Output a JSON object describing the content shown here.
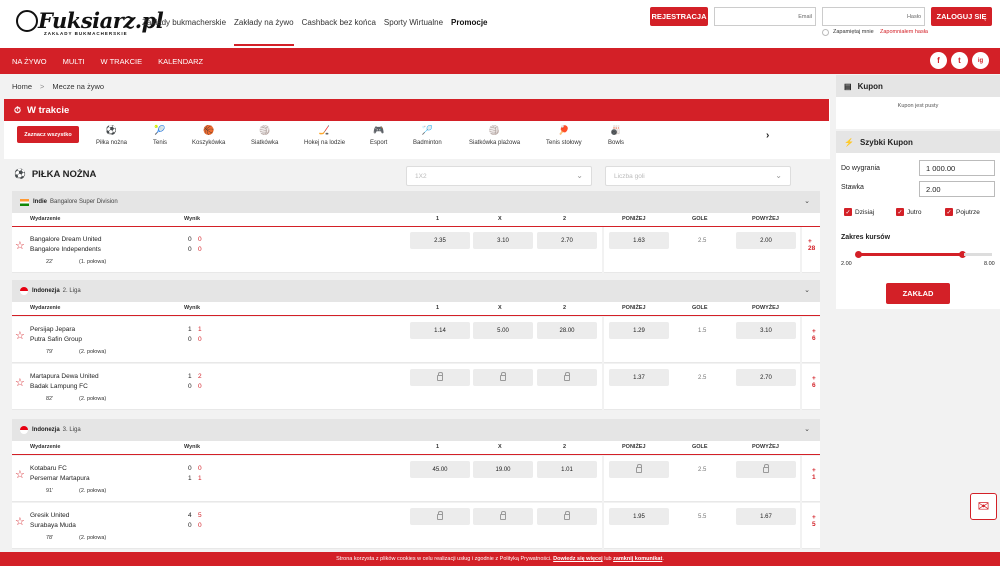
{
  "logo": {
    "text": "Fuksiarz.pl",
    "subtext": "ZAKŁADY BUKMACHERSKIE"
  },
  "topnav": [
    "Zakłady bukmacherskie",
    "Zakłady na żywo",
    "Cashback bez końca",
    "Sporty Wirtualne",
    "Promocje"
  ],
  "auth": {
    "register": "REJESTRACJA",
    "email_placeholder": "Email",
    "password_placeholder": "Hasło",
    "remember": "Zapamiętaj mnie",
    "forgot": "Zapomniałem hasła",
    "login": "ZALOGUJ SIĘ"
  },
  "rednav": [
    "NA ŻYWO",
    "MULTI",
    "W TRAKCIE",
    "KALENDARZ"
  ],
  "social": [
    "f",
    "t",
    "ig"
  ],
  "breadcrumb": {
    "home": "Home",
    "current": "Mecze na żywo"
  },
  "section_title": "W trakcie",
  "select_all": "Zaznacz wszystko",
  "sports": [
    {
      "icon": "soccer-ball-icon",
      "glyph": "⚽",
      "label": "Piłka nożna"
    },
    {
      "icon": "tennis-icon",
      "glyph": "🎾",
      "label": "Tenis"
    },
    {
      "icon": "basketball-icon",
      "glyph": "🏀",
      "label": "Koszykówka"
    },
    {
      "icon": "volleyball-icon",
      "glyph": "🏐",
      "label": "Siatkówka"
    },
    {
      "icon": "hockey-icon",
      "glyph": "🏒",
      "label": "Hokej na lodzie"
    },
    {
      "icon": "gamepad-icon",
      "glyph": "🎮",
      "label": "Esport"
    },
    {
      "icon": "badminton-icon",
      "glyph": "🏸",
      "label": "Badminton"
    },
    {
      "icon": "beach-volleyball-icon",
      "glyph": "🏐",
      "label": "Siatkówka plażowa"
    },
    {
      "icon": "table-tennis-icon",
      "glyph": "🏓",
      "label": "Tenis stołowy"
    },
    {
      "icon": "bowling-icon",
      "glyph": "🎳",
      "label": "Bowls"
    }
  ],
  "football": {
    "title": "PIŁKA NOŻNA",
    "dropdown1": "1X2",
    "dropdown2": "Liczba goli"
  },
  "colhdr": {
    "event": "Wydarzenie",
    "result": "Wynik",
    "one": "1",
    "x": "X",
    "two": "2",
    "under": "PONIŻEJ",
    "goals": "GOLE",
    "over": "POWYŻEJ"
  },
  "leagues": [
    {
      "country": "Indie",
      "name": "Bangalore Super Division",
      "flag": "india",
      "matches": [
        {
          "home": "Bangalore Dream United",
          "away": "Bangalore Independents",
          "hs1": "0",
          "hs2": "0",
          "as1": "0",
          "as2": "0",
          "minute": "22'",
          "period": "(1. połowa)",
          "o1": "2.35",
          "ox": "3.10",
          "o2": "2.70",
          "under": "1.63",
          "goals": "2.5",
          "over": "2.00",
          "more": "+ 28"
        }
      ]
    },
    {
      "country": "Indonezja",
      "name": "2. Liga",
      "flag": "indonesia",
      "matches": [
        {
          "home": "Persijap Jepara",
          "away": "Putra Safin Group",
          "hs1": "1",
          "hs2": "1",
          "as1": "0",
          "as2": "0",
          "minute": "79'",
          "period": "(2. połowa)",
          "o1": "1.14",
          "ox": "5.00",
          "o2": "28.00",
          "under": "1.29",
          "goals": "1.5",
          "over": "3.10",
          "more": "+ 6"
        },
        {
          "home": "Martapura Dewa United",
          "away": "Badak Lampung FC",
          "hs1": "1",
          "hs2": "2",
          "as1": "0",
          "as2": "0",
          "minute": "82'",
          "period": "(2. połowa)",
          "o1": "",
          "ox": "",
          "o2": "",
          "under": "1.37",
          "goals": "2.5",
          "over": "2.70",
          "more": "+ 6"
        }
      ]
    },
    {
      "country": "Indonezja",
      "name": "3. Liga",
      "flag": "indonesia",
      "matches": [
        {
          "home": "Kotabaru FC",
          "away": "Persemar Martapura",
          "hs1": "0",
          "hs2": "0",
          "as1": "1",
          "as2": "1",
          "minute": "91'",
          "period": "(2. połowa)",
          "o1": "45.00",
          "ox": "19.00",
          "o2": "1.01",
          "under": "",
          "goals": "2.5",
          "over": "",
          "more": "+ 1"
        },
        {
          "home": "Gresik United",
          "away": "Surabaya Muda",
          "hs1": "4",
          "hs2": "5",
          "as1": "0",
          "as2": "0",
          "minute": "78'",
          "period": "(2. połowa)",
          "o1": "",
          "ox": "",
          "o2": "",
          "under": "1.95",
          "goals": "5.5",
          "over": "1.67",
          "more": "+ 5"
        }
      ]
    }
  ],
  "kupon": {
    "title": "Kupon",
    "empty": "Kupon jest pusty"
  },
  "quick": {
    "title": "Szybki Kupon",
    "win_label": "Do wygrania",
    "win_value": "1 000.00",
    "stake_label": "Stawka",
    "stake_value": "2.00",
    "days": [
      "Dzisiaj",
      "Jutro",
      "Pojutrze"
    ],
    "range_label": "Zakres kursów",
    "range_min": "2.00",
    "range_max": "8.00",
    "submit": "ZAKŁAD"
  },
  "cookie": {
    "text": "Strona korzysta z plików cookies w celu realizacji usług i zgodnie z Polityką Prywatności.",
    "link1": "Dowiedz się więcej",
    "mid": "lub",
    "link2": "zamknij komunikat"
  },
  "colors": {
    "accent": "#d32027",
    "grey": "#e5e5e5"
  }
}
